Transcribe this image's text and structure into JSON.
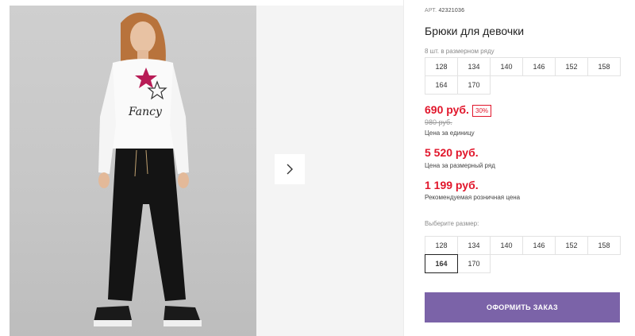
{
  "product": {
    "art_prefix": "АРТ.",
    "art_number": "42321036",
    "title": "Брюки для девочки",
    "pack_note": "8 шт. в размерном ряду",
    "pack_sizes": [
      "128",
      "134",
      "140",
      "146",
      "152",
      "158",
      "164",
      "170"
    ],
    "price_sale": "690 руб.",
    "discount_badge": "30%",
    "price_old": "980 руб.",
    "unit_price_label": "Цена за единицу",
    "price_row": "5 520 руб.",
    "row_price_label": "Цена за размерный ряд",
    "price_rrp": "1 199 руб.",
    "rrp_label": "Рекомендуемая розничная цена",
    "choose_size_label": "Выберите размер:",
    "sizes": [
      "128",
      "134",
      "140",
      "146",
      "152",
      "158",
      "164",
      "170"
    ],
    "selected_size": "164",
    "order_button": "ОФОРМИТЬ ЗАКАЗ"
  },
  "gallery": {
    "photo_print_text": "Fancy",
    "next_icon": "chevron-right-icon"
  },
  "colors": {
    "accent_price": "#e1162b",
    "order_button_bg": "#7b63a8"
  }
}
